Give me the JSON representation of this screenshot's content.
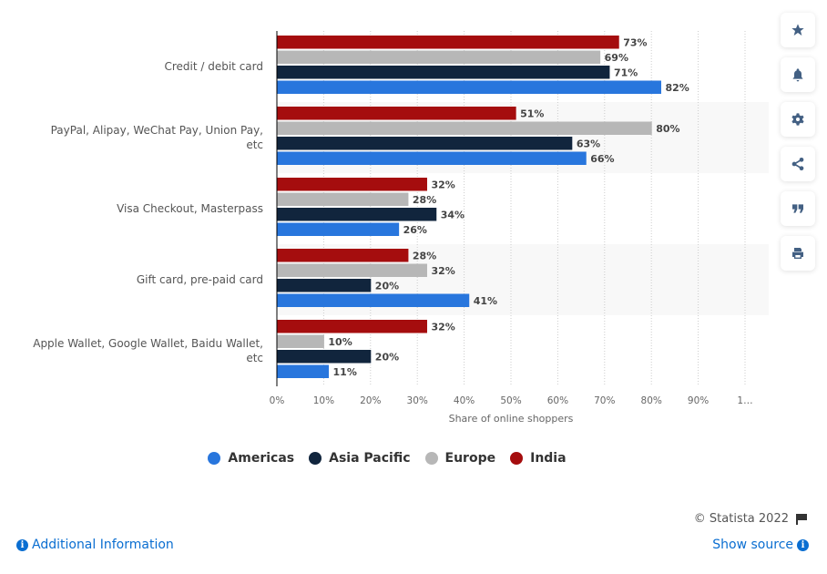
{
  "chart_data": {
    "type": "bar",
    "orientation": "horizontal",
    "categories": [
      "Credit / debit card",
      "PayPal, Alipay, WeChat Pay, Union Pay, etc",
      "Visa Checkout, Masterpass",
      "Gift card, pre-paid card",
      "Apple Wallet, Google Wallet, Baidu Wallet, etc"
    ],
    "category_lines": [
      [
        "Credit / debit card"
      ],
      [
        "PayPal, Alipay, WeChat Pay, Union Pay,",
        "etc"
      ],
      [
        "Visa Checkout, Masterpass"
      ],
      [
        "Gift card, pre-paid card"
      ],
      [
        "Apple Wallet, Google Wallet, Baidu Wallet,",
        "etc"
      ]
    ],
    "series": [
      {
        "name": "India",
        "color": "#a50d0e",
        "values": [
          73,
          51,
          32,
          28,
          32
        ]
      },
      {
        "name": "Europe",
        "color": "#b7b7b7",
        "values": [
          69,
          80,
          28,
          32,
          10
        ]
      },
      {
        "name": "Asia Pacific",
        "color": "#11253d",
        "values": [
          71,
          63,
          34,
          20,
          20
        ]
      },
      {
        "name": "Americas",
        "color": "#2876dd",
        "values": [
          82,
          66,
          26,
          41,
          11
        ]
      }
    ],
    "value_suffix": "%",
    "xlabel": "Share of online shoppers",
    "ylabel": "",
    "xlim": [
      0,
      100
    ],
    "xticks": [
      "0%",
      "10%",
      "20%",
      "30%",
      "40%",
      "50%",
      "60%",
      "70%",
      "80%",
      "90%",
      "1…"
    ],
    "grid": true,
    "legend_position": "bottom-center"
  },
  "legend": [
    {
      "name": "Americas",
      "color": "#2876dd"
    },
    {
      "name": "Asia Pacific",
      "color": "#11253d"
    },
    {
      "name": "Europe",
      "color": "#b7b7b7"
    },
    {
      "name": "India",
      "color": "#a50d0e"
    }
  ],
  "sidebar": {
    "buttons": [
      {
        "name": "favorite-button",
        "icon": "star-icon"
      },
      {
        "name": "notification-button",
        "icon": "bell-icon"
      },
      {
        "name": "settings-button",
        "icon": "gear-icon"
      },
      {
        "name": "share-button",
        "icon": "share-icon"
      },
      {
        "name": "cite-button",
        "icon": "quote-icon"
      },
      {
        "name": "print-button",
        "icon": "print-icon"
      }
    ]
  },
  "footer": {
    "copyright": "© Statista 2022",
    "additional_info": "Additional Information",
    "show_source": "Show source",
    "info_glyph": "i"
  }
}
